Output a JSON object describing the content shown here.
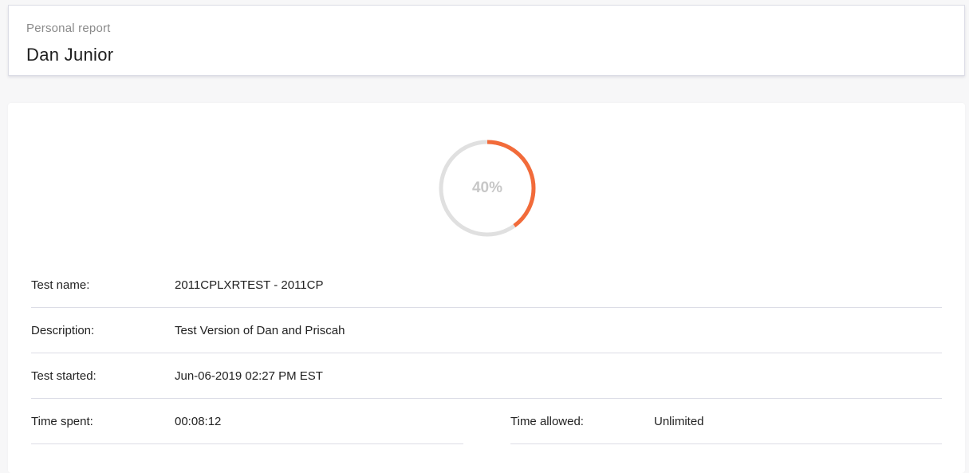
{
  "header": {
    "subtitle": "Personal report",
    "title": "Dan Junior"
  },
  "progress": {
    "percent_label": "40%",
    "fraction": 0.4,
    "track_color": "#e0e0e0",
    "fill_color": "#f26b3a",
    "label_color": "#c7c7c7"
  },
  "details": {
    "test_name": {
      "label": "Test name:",
      "value": "2011CPLXRTEST - 2011CP"
    },
    "description": {
      "label": "Description:",
      "value": "Test Version of Dan and Priscah"
    },
    "test_started": {
      "label": "Test started:",
      "value": "Jun-06-2019 02:27 PM EST"
    },
    "time_spent": {
      "label": "Time spent:",
      "value": "00:08:12"
    },
    "time_allowed": {
      "label": "Time allowed:",
      "value": "Unlimited"
    }
  }
}
